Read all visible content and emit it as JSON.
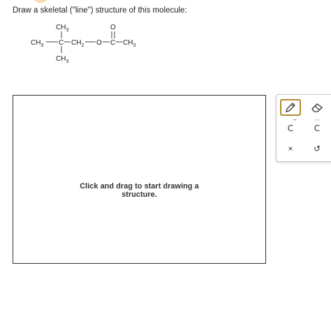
{
  "prompt": "Draw a skeletal (\"line\") structure of this molecule:",
  "molecule": {
    "top_methyl": "CH3",
    "left_methyl": "CH3",
    "bottom_methyl": "CH3",
    "central_carbon": "C",
    "methylene": "CH2",
    "oxygen": "O",
    "carbonyl_carbon": "C",
    "carbonyl_oxygen": "O",
    "right_methyl": "CH3"
  },
  "canvas": {
    "hint_line1": "Click and drag to start drawing a",
    "hint_line2": "structure."
  },
  "toolbar": {
    "icons": [
      "pencil-icon",
      "eraser-icon",
      "carbanion-icon",
      "carbocation-icon",
      "clear-icon",
      "undo-icon"
    ],
    "carbanion": "C",
    "carbocation": "C",
    "clear": "×",
    "undo": "↺",
    "accent": "#b08a2e"
  },
  "colors": {
    "chevron_bg": "#f6dfae",
    "chevron_arrow": "#c99a2e"
  }
}
